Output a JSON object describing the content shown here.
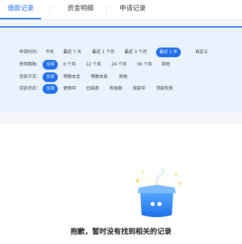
{
  "tabs": [
    {
      "label": "借款记录",
      "active": true
    },
    {
      "label": "资金明细",
      "active": false
    },
    {
      "label": "申请记录",
      "active": false
    }
  ],
  "filters": {
    "apply_time": {
      "label": "申请时间：",
      "options": [
        "今天",
        "最近 7 天",
        "最近 1 个月",
        "最近 3 个月",
        "最近 1 年",
        "自定义"
      ],
      "selected": "最近 1 年"
    },
    "period": {
      "label": "使用期限：",
      "options": [
        "全部",
        "6 个月",
        "12 个月",
        "24 个月",
        "36 个月",
        "其他"
      ],
      "selected": "全部"
    },
    "repay_method": {
      "label": "还款方式：",
      "options": [
        "全部",
        "等额本金",
        "等额本息",
        "其他"
      ],
      "selected": "全部"
    },
    "loan_status": {
      "label": "贷款状态：",
      "options": [
        "全部",
        "使用中",
        "已结清",
        "有逾期",
        "放款中",
        "贷款失败"
      ],
      "selected": "全部"
    }
  },
  "empty_state": {
    "icon": "empty-box-icon",
    "message": "抱歉，暂时没有找到相关的记录"
  },
  "colors": {
    "accent": "#1e6fe8",
    "panel_bg": "#eaf2fd",
    "page_bg": "#f3f5f8"
  }
}
